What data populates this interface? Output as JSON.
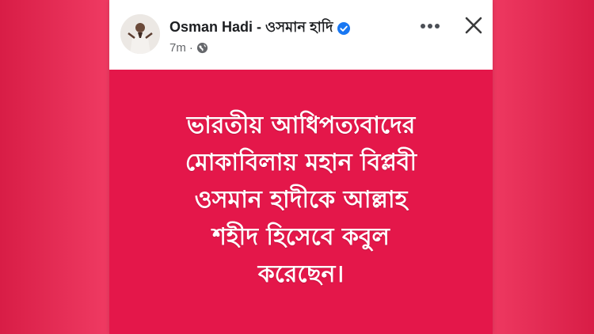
{
  "post": {
    "author": "Osman Hadi - ওসমান হাদি",
    "time": "7m",
    "separator": "·",
    "text_lines": [
      "ভারতীয় আধিপত্যবাদের",
      "মোকাবিলায় মহান বিপ্লবী",
      "ওসমান হাদীকে আল্লাহ",
      "শহীদ হিসেবে কবুল",
      "করেছেন।"
    ],
    "background_color": "#e4174a",
    "text_color": "#ffffff"
  },
  "icons": {
    "verified": "verified-badge-icon",
    "audience": "globe-icon",
    "more": "more-horizontal-icon",
    "close": "close-icon"
  }
}
